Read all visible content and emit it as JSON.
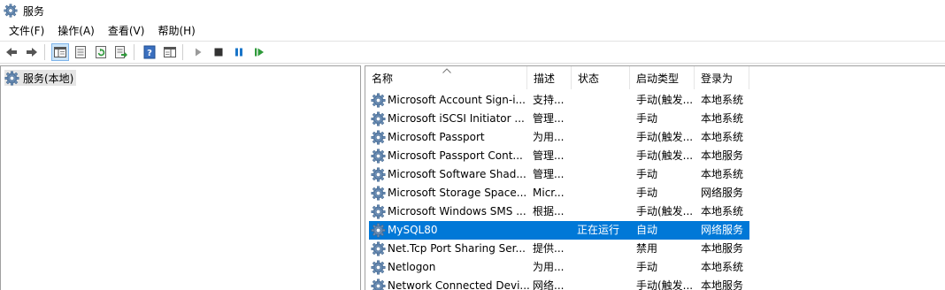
{
  "window": {
    "title": "服务"
  },
  "menu": [
    "文件(F)",
    "操作(A)",
    "查看(V)",
    "帮助(H)"
  ],
  "toolbar": {
    "buttons": [
      "back-icon",
      "forward-icon",
      "show-hide-tree-icon",
      "properties-icon",
      "refresh-icon",
      "export-list-icon",
      "help-icon",
      "view-icon",
      "start-service-icon",
      "stop-service-icon",
      "pause-service-icon",
      "restart-service-icon"
    ]
  },
  "tree": {
    "root": "服务(本地)"
  },
  "table": {
    "columns": [
      "名称",
      "描述",
      "状态",
      "启动类型",
      "登录为"
    ],
    "rows": [
      [
        "Microsoft Account Sign-i...",
        "支持...",
        "",
        "手动(触发...",
        "本地系统"
      ],
      [
        "Microsoft iSCSI Initiator ...",
        "管理...",
        "",
        "手动",
        "本地系统"
      ],
      [
        "Microsoft Passport",
        "为用...",
        "",
        "手动(触发...",
        "本地系统"
      ],
      [
        "Microsoft Passport Cont...",
        "管理...",
        "",
        "手动(触发...",
        "本地服务"
      ],
      [
        "Microsoft Software Shad...",
        "管理...",
        "",
        "手动",
        "本地系统"
      ],
      [
        "Microsoft Storage Space...",
        "Micr...",
        "",
        "手动",
        "网络服务"
      ],
      [
        "Microsoft Windows SMS ...",
        "根据...",
        "",
        "手动(触发...",
        "本地系统"
      ],
      [
        "MySQL80",
        "",
        "正在运行",
        "自动",
        "网络服务"
      ],
      [
        "Net.Tcp Port Sharing Ser...",
        "提供...",
        "",
        "禁用",
        "本地服务"
      ],
      [
        "Netlogon",
        "为用...",
        "",
        "手动",
        "本地系统"
      ],
      [
        "Network Connected Devi...",
        "网络...",
        "",
        "手动(触发...",
        "本地服务"
      ]
    ],
    "selected_row": 7
  },
  "colors": {
    "selection": "#0078d7",
    "accent": "#1a75c8"
  }
}
